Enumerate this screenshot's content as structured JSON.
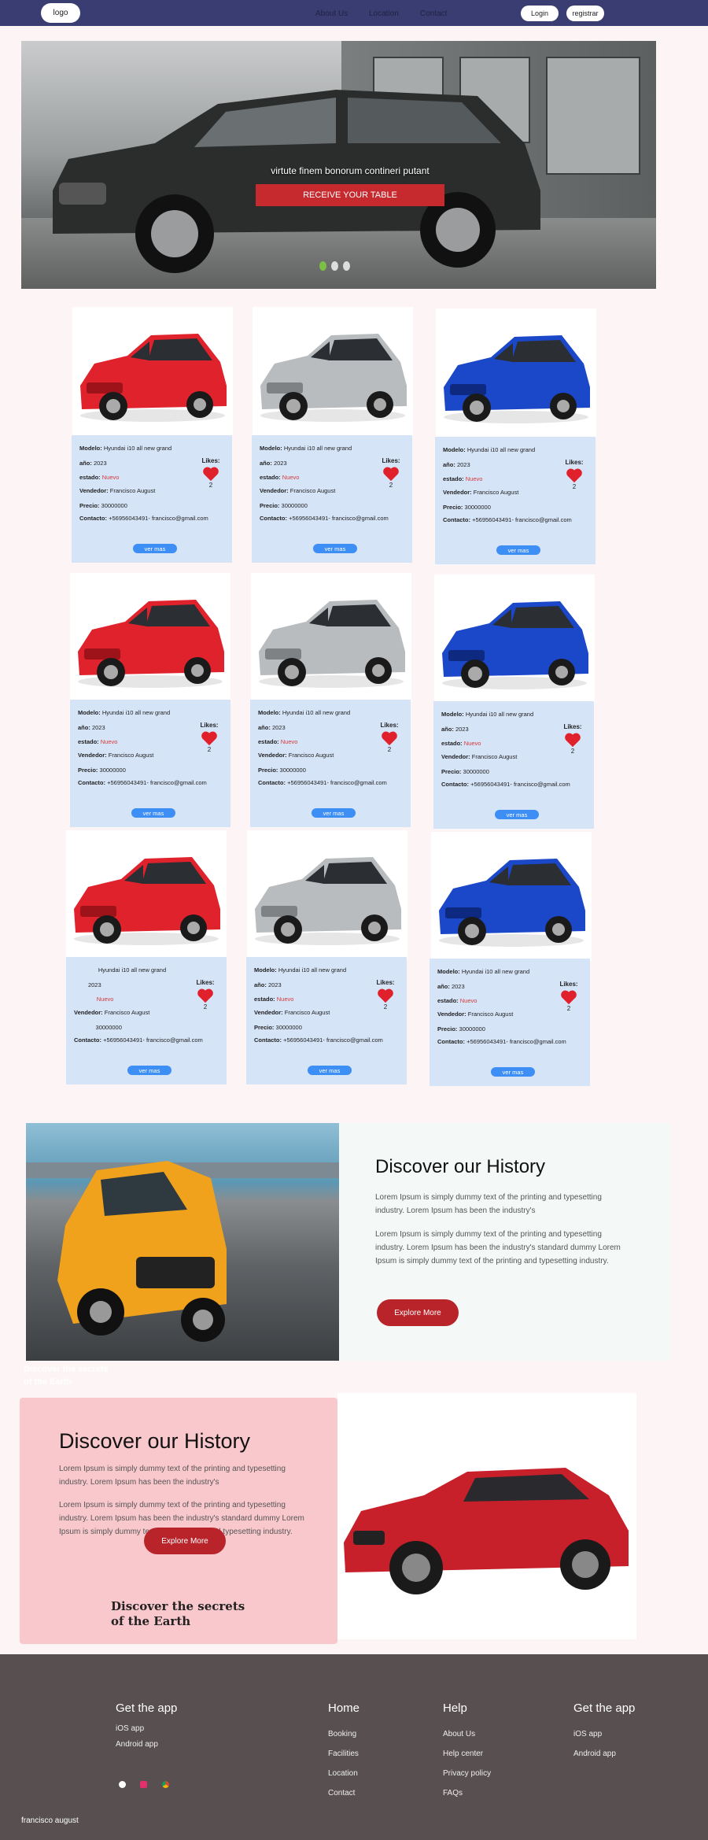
{
  "nav": {
    "logo": "logo",
    "links": [
      "About Us",
      "Location",
      "Contact"
    ],
    "login": "Login",
    "register": "registrar"
  },
  "hero": {
    "caption": "virtute finem bonorum contineri putant",
    "cta": "RECEIVE YOUR TABLE"
  },
  "colors": {
    "nav": "#3a3d72",
    "cta": "#c62a2f",
    "card_info": "#d6e4f8",
    "button": "#3d8ef5",
    "heart": "#e0202a",
    "footer": "#574f50",
    "pink_box": "#f9c8cc"
  },
  "labels": {
    "modelo": "Modelo:",
    "anio": "año:",
    "estado": "estado:",
    "vendedor": "Vendedor:",
    "precio": "Precio:",
    "contacto": "Contacto:",
    "likes": "Likes:",
    "ver_mas": "ver mas"
  },
  "cards": [
    {
      "model": "Hyundai i10 all new grand",
      "year": "2023",
      "status": "Nuevo",
      "seller": "Francisco August",
      "price": "30000000",
      "contact": "+56956043491- francisco@gmail.com",
      "likes": "2",
      "car_color": "red"
    },
    {
      "model": "Hyundai i10 all new grand",
      "year": "2023",
      "status": "Nuevo",
      "seller": "Francisco August",
      "price": "30000000",
      "contact": "+56956043491- francisco@gmail.com",
      "likes": "2",
      "car_color": "silver"
    },
    {
      "model": "Hyundai i10 all new grand",
      "year": "2023",
      "status": "Nuevo",
      "seller": "Francisco August",
      "price": "30000000",
      "contact": "+56956043491- francisco@gmail.com",
      "likes": "2",
      "car_color": "blue"
    },
    {
      "model": "Hyundai i10 all new grand",
      "year": "2023",
      "status": "Nuevo",
      "seller": "Francisco August",
      "price": "30000000",
      "contact": "+56956043491- francisco@gmail.com",
      "likes": "2",
      "car_color": "red"
    },
    {
      "model": "Hyundai i10 all new grand",
      "year": "2023",
      "status": "Nuevo",
      "seller": "Francisco August",
      "price": "30000000",
      "contact": "+56956043491- francisco@gmail.com",
      "likes": "2",
      "car_color": "silver"
    },
    {
      "model": "Hyundai i10 all new grand",
      "year": "2023",
      "status": "Nuevo",
      "seller": "Francisco August",
      "price": "30000000",
      "contact": "+56956043491- francisco@gmail.com",
      "likes": "2",
      "car_color": "blue"
    },
    {
      "model": "Hyundai i10 all new grand",
      "year": "2023",
      "status": "Nuevo",
      "seller": "Francisco August",
      "price": "30000000",
      "contact": "+56956043491- francisco@gmail.com",
      "likes": "2",
      "car_color": "red",
      "hide_labels": true
    },
    {
      "model": "Hyundai i10 all new grand",
      "year": "2023",
      "status": "Nuevo",
      "seller": "Francisco August",
      "price": "30000000",
      "contact": "+56956043491- francisco@gmail.com",
      "likes": "2",
      "car_color": "silver"
    },
    {
      "model": "Hyundai i10 all new grand",
      "year": "2023",
      "status": "Nuevo",
      "seller": "Francisco August",
      "price": "30000000",
      "contact": "+56956043491- francisco@gmail.com",
      "likes": "2",
      "car_color": "blue"
    }
  ],
  "history1": {
    "title": "Discover our History",
    "p1": "Lorem Ipsum is simply dummy text of the printing and typesetting industry. Lorem Ipsum has been the industry's",
    "p2": "Lorem Ipsum is simply dummy text of the printing and typesetting industry. Lorem Ipsum has been the industry's standard dummy Lorem Ipsum is simply dummy text of the printing and typesetting industry.",
    "button": "Explore More",
    "faint_line1": "Discover the secrets",
    "faint_line2": "of the Earth"
  },
  "history2": {
    "title": "Discover our History",
    "p1": "Lorem Ipsum is simply dummy text of the printing and typesetting industry. Lorem Ipsum has been the industry's",
    "p2": "Lorem Ipsum is simply dummy text of the printing and typesetting industry. Lorem Ipsum has been the industry's standard dummy Lorem Ipsum is simply dummy text of the printing and typesetting industry.",
    "button": "Explore More",
    "secrets_line1": "Discover the secrets",
    "secrets_line2": "of the Earth"
  },
  "footer": {
    "col1": {
      "title": "Get the app",
      "items": [
        "iOS app",
        "Android app"
      ]
    },
    "col2": {
      "title": "Home",
      "items": [
        "Booking",
        "Facilities",
        "Location",
        "Contact"
      ]
    },
    "col3": {
      "title": "Help",
      "items": [
        "About Us",
        "Help center",
        "Privacy policy",
        "FAQs"
      ]
    },
    "col4": {
      "title": "Get the app",
      "items": [
        "iOS app",
        "Android app"
      ]
    },
    "socials": [
      "circle-icon",
      "instagram-icon",
      "chrome-icon"
    ],
    "copyright": "francisco august"
  }
}
